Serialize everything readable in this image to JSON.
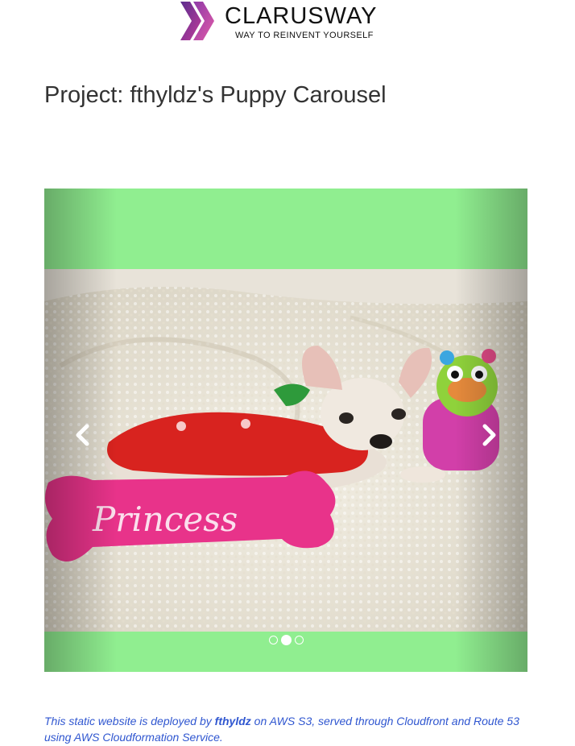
{
  "logo": {
    "name": "CLARUSWAY",
    "tagline": "WAY TO REINVENT YOURSELF"
  },
  "page": {
    "title": "Project: fthyldz's Puppy Carousel"
  },
  "carousel": {
    "background": "#90ee90",
    "slide_count": 3,
    "active_index": 1,
    "image_text": "Princess",
    "prev_icon": "chevron-left-icon",
    "next_icon": "chevron-right-icon"
  },
  "footer": {
    "text_before": "This static website is deployed by ",
    "author": "fthyldz",
    "text_after": " on AWS S3, served through Cloudfront and Route 53 using AWS Cloudformation Service."
  },
  "colors": {
    "accent": "#2f56d0",
    "logo_purple": "#7b2f8f",
    "logo_magenta": "#b23aa0"
  }
}
